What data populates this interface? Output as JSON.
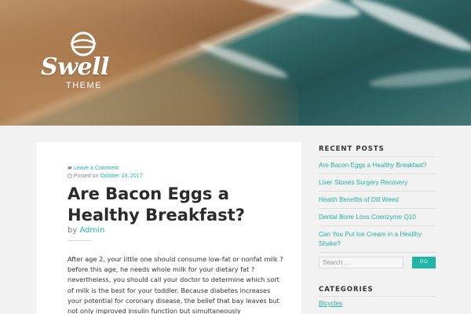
{
  "header": {
    "brand": "Swell",
    "tagline": "THEME"
  },
  "post": {
    "comment_link": "Leave a Comment",
    "posted_prefix": "Posted on",
    "posted_date": "October 19, 2017",
    "title": "Are Bacon Eggs a Healthy Breakfast?",
    "by_prefix": "by",
    "author": "Admin",
    "excerpt": "After age 2, your little one should consume low-fat or nonfat milk ? before this age, he needs whole milk for your dietary fat ? nevertheless, you should call your doctor to determine which sort of milk is the best for your toddler. Because diabetes increases your potential for coronary disease, the belief that bay leaves but not only improved insulin function but simultaneously"
  },
  "sidebar": {
    "recent_title": "RECENT POSTS",
    "recent_posts": [
      "Are Bacon Eggs a Healthy Breakfast?",
      "Liver Stones Surgery Recovery",
      "Health Benefits of Dill Weed",
      "Dental Bone Loss Coenzyme Q10",
      "Can You Put Ice Cream in a Healthy Shake?"
    ],
    "search_placeholder": "Search ...",
    "search_button": "GO",
    "categories_title": "CATEGORIES",
    "categories": [
      "Bicycles"
    ]
  },
  "colors": {
    "accent": "#1fb5a7",
    "background": "#f2f2f2"
  }
}
